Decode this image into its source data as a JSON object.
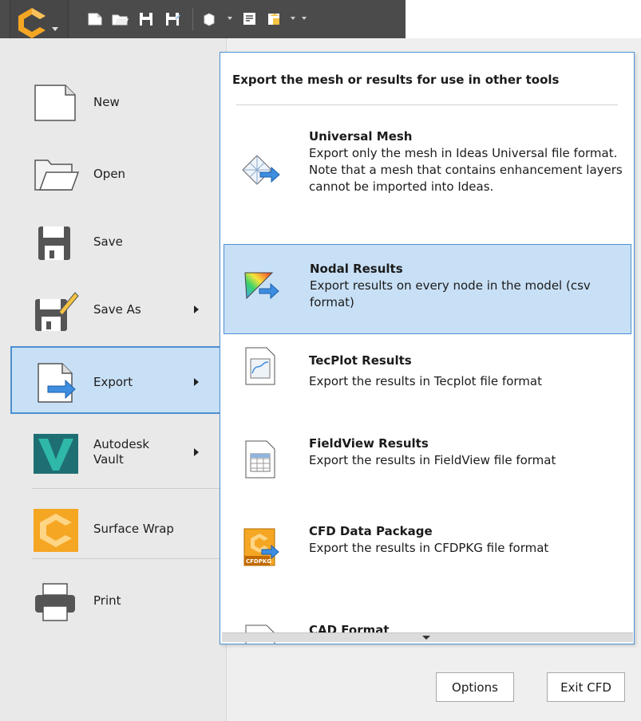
{
  "quick_access": {
    "items": [
      "new-icon",
      "open-icon",
      "save-icon",
      "save-as-icon",
      "view-cube-icon",
      "select-icon",
      "display-icon",
      "customize-icon"
    ]
  },
  "menu": {
    "items": [
      {
        "label": "New",
        "icon": "new-document-icon",
        "has_submenu": false
      },
      {
        "label": "Open",
        "icon": "folder-icon",
        "has_submenu": false
      },
      {
        "label": "Save",
        "icon": "floppy-disk-icon",
        "has_submenu": false
      },
      {
        "label": "Save As",
        "icon": "save-as-icon",
        "has_submenu": true
      },
      {
        "label": "Export",
        "icon": "export-icon",
        "has_submenu": true,
        "selected": true
      },
      {
        "label": "Autodesk\nVault",
        "icon": "vault-icon",
        "has_submenu": true
      },
      {
        "label": "Surface Wrap",
        "icon": "cfd-logo-icon",
        "has_submenu": false
      },
      {
        "label": "Print",
        "icon": "printer-icon",
        "has_submenu": false
      }
    ]
  },
  "flyout": {
    "header": "Export the mesh or results for use in other tools",
    "items": [
      {
        "title": "Universal Mesh",
        "description": "Export only the mesh in Ideas Universal file format. Note that a mesh that contains enhancement layers cannot be imported into Ideas.",
        "icon": "mesh-export-icon"
      },
      {
        "title": "Nodal Results",
        "description": "Export results on every node in the model (csv format)",
        "icon": "nodal-results-icon",
        "highlighted": true
      },
      {
        "title": "TecPlot Results",
        "description": "Export the results in Tecplot file format",
        "icon": "tecplot-icon"
      },
      {
        "title": "FieldView Results",
        "description": "Export the results in FieldView file format",
        "icon": "fieldview-icon"
      },
      {
        "title": "CFD Data Package",
        "description": "Export the results in CFDPKG file format",
        "icon": "cfdpkg-icon",
        "icon_text": "CFDPKG"
      },
      {
        "title": "CAD Format",
        "description": "",
        "icon": "cad-format-icon"
      }
    ]
  },
  "buttons": {
    "options": "Options",
    "exit": "Exit CFD"
  },
  "colors": {
    "selection_fill": "#c8e0f6",
    "selection_border": "#4d8fd0",
    "toolbar": "#4b4b4b",
    "logo_orange": "#f5a623"
  }
}
